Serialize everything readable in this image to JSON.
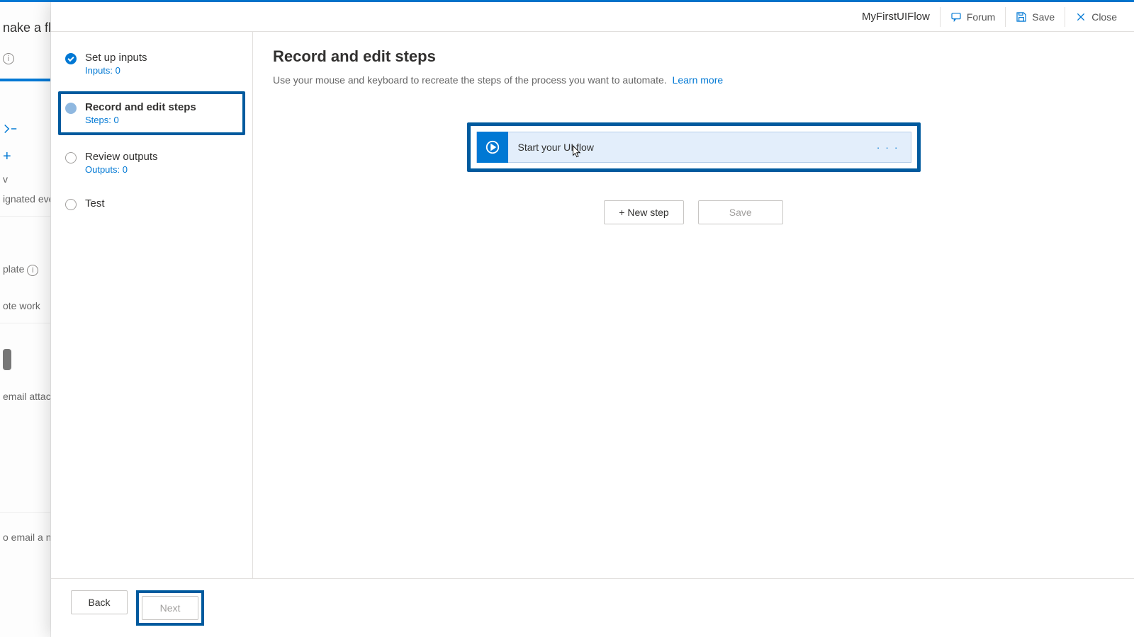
{
  "background": {
    "heading_fragment": "nake a fl",
    "line1": "v",
    "line2": "ignated even",
    "line3": "plate",
    "line4": "ote work",
    "line5": "email attac",
    "line6": "o email a n"
  },
  "header": {
    "flow_name": "MyFirstUIFlow",
    "forum": "Forum",
    "save": "Save",
    "close": "Close"
  },
  "steps": [
    {
      "title": "Set up inputs",
      "sub": "Inputs: 0",
      "state": "done"
    },
    {
      "title": "Record and edit steps",
      "sub": "Steps: 0",
      "state": "active"
    },
    {
      "title": "Review outputs",
      "sub": "Outputs: 0",
      "state": "todo"
    },
    {
      "title": "Test",
      "sub": "",
      "state": "todo"
    }
  ],
  "main": {
    "title": "Record and edit steps",
    "desc": "Use your mouse and keyboard to recreate the steps of the process you want to automate.",
    "learn_more": "Learn more",
    "card_label": "Start your UI flow",
    "new_step": "+ New step",
    "save": "Save"
  },
  "footer": {
    "back": "Back",
    "next": "Next"
  }
}
